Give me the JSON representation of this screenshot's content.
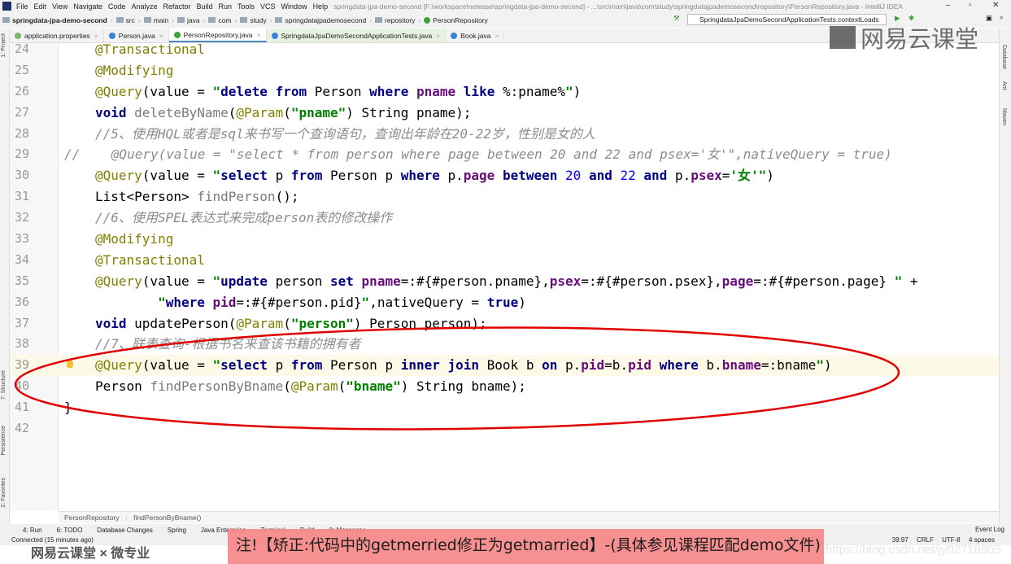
{
  "menubar": {
    "items": [
      "File",
      "Edit",
      "View",
      "Navigate",
      "Code",
      "Analyze",
      "Refactor",
      "Build",
      "Run",
      "Tools",
      "VCS",
      "Window",
      "Help"
    ],
    "title": "springdata-jpa-demo-second [F:\\workspace\\netease\\springdata-jpa-demo-second] - ...\\src\\main\\java\\com\\study\\springdatajpademosecond\\repository\\PersonRepository.java - IntelliJ IDEA"
  },
  "navbar": {
    "crumbs": [
      "springdata-jpa-demo-second",
      "src",
      "main",
      "java",
      "com",
      "study",
      "springdatajpademosecond",
      "repository",
      "PersonRepository"
    ],
    "run_config": "SpringdataJpaDemoSecondApplicationTests.contextLoads"
  },
  "tabs": [
    {
      "label": "application.properties"
    },
    {
      "label": "Person.java"
    },
    {
      "label": "PersonRepository.java",
      "active": true
    },
    {
      "label": "SpringdataJpaDemoSecondApplicationTests.java"
    },
    {
      "label": "Book.java"
    }
  ],
  "left_tools": [
    "1: Project",
    "7: Structure",
    "Persistence",
    "2: Favorites"
  ],
  "right_tools": [
    "Database",
    "Ant",
    "Maven"
  ],
  "code": {
    "lines": [
      {
        "n": "24",
        "t": [
          [
            "ann",
            "@Transactional"
          ]
        ]
      },
      {
        "n": "25",
        "t": [
          [
            "ann",
            "@Modifying"
          ]
        ]
      },
      {
        "n": "26",
        "t": [
          [
            "ann",
            "@Query"
          ],
          [
            "pl",
            "(value = "
          ],
          [
            "str",
            "\""
          ],
          [
            "kw",
            "delete"
          ],
          [
            "pl",
            " "
          ],
          [
            "kw",
            "from"
          ],
          [
            "pl",
            " Person "
          ],
          [
            "kw",
            "where"
          ],
          [
            "pl",
            " "
          ],
          [
            "fld",
            "pname"
          ],
          [
            "pl",
            " "
          ],
          [
            "kw",
            "like"
          ],
          [
            "pl",
            " %:pname%"
          ],
          [
            "str",
            "\""
          ],
          [
            "pl",
            ")"
          ]
        ]
      },
      {
        "n": "27",
        "t": [
          [
            "kw",
            "void"
          ],
          [
            "pl",
            " "
          ],
          [
            "un",
            "deleteByName"
          ],
          [
            "pl",
            "("
          ],
          [
            "ann",
            "@Param"
          ],
          [
            "pl",
            "("
          ],
          [
            "str",
            "\"pname\""
          ],
          [
            "pl",
            ") String pname);"
          ]
        ]
      },
      {
        "n": "28",
        "t": [
          [
            "cmt",
            "//5、使用HQL或者是sql来书写一个查询语句，查询出年龄在20-22岁，性别是女的人"
          ]
        ]
      },
      {
        "n": "29",
        "t": [
          [
            "cmt",
            "//    @Query(value = \"select * from person where page between 20 and 22 and psex='女'\",nativeQuery = true)"
          ]
        ],
        "outdent": true
      },
      {
        "n": "30",
        "t": [
          [
            "ann",
            "@Query"
          ],
          [
            "pl",
            "(value = "
          ],
          [
            "str",
            "\""
          ],
          [
            "kw",
            "select"
          ],
          [
            "pl",
            " p "
          ],
          [
            "kw",
            "from"
          ],
          [
            "pl",
            " Person p "
          ],
          [
            "kw",
            "where"
          ],
          [
            "pl",
            " p."
          ],
          [
            "fld",
            "page"
          ],
          [
            "pl",
            " "
          ],
          [
            "kw",
            "between"
          ],
          [
            "pl",
            " "
          ],
          [
            "num",
            "20"
          ],
          [
            "pl",
            " "
          ],
          [
            "kw",
            "and"
          ],
          [
            "pl",
            " "
          ],
          [
            "num",
            "22"
          ],
          [
            "pl",
            " "
          ],
          [
            "kw",
            "and"
          ],
          [
            "pl",
            " p."
          ],
          [
            "fld",
            "psex"
          ],
          [
            "pl",
            "="
          ],
          [
            "str",
            "'女'"
          ],
          [
            "str",
            "\""
          ],
          [
            "pl",
            ")"
          ]
        ]
      },
      {
        "n": "31",
        "t": [
          [
            "pl",
            "List<Person> "
          ],
          [
            "un",
            "findPerson"
          ],
          [
            "pl",
            "();"
          ]
        ]
      },
      {
        "n": "32",
        "t": [
          [
            "cmt",
            "//6、使用SPEL表达式来完成person表的修改操作"
          ]
        ]
      },
      {
        "n": "33",
        "t": [
          [
            "ann",
            "@Modifying"
          ]
        ]
      },
      {
        "n": "34",
        "t": [
          [
            "ann",
            "@Transactional"
          ]
        ]
      },
      {
        "n": "35",
        "t": [
          [
            "ann",
            "@Query"
          ],
          [
            "pl",
            "(value = "
          ],
          [
            "str",
            "\""
          ],
          [
            "kw",
            "update"
          ],
          [
            "pl",
            " person "
          ],
          [
            "kw",
            "set"
          ],
          [
            "pl",
            " "
          ],
          [
            "fld",
            "pname"
          ],
          [
            "pl",
            "=:#{#person.pname},"
          ],
          [
            "fld",
            "psex"
          ],
          [
            "pl",
            "=:#{#person.psex},"
          ],
          [
            "fld",
            "page"
          ],
          [
            "pl",
            "=:#{#person.page} "
          ],
          [
            "str",
            "\""
          ],
          [
            "pl",
            " +"
          ]
        ]
      },
      {
        "n": "36",
        "t": [
          [
            "pl",
            "        "
          ],
          [
            "str",
            "\""
          ],
          [
            "kw",
            "where"
          ],
          [
            "pl",
            " "
          ],
          [
            "fld",
            "pid"
          ],
          [
            "pl",
            "=:#{#person.pid}"
          ],
          [
            "str",
            "\""
          ],
          [
            "pl",
            ",nativeQuery = "
          ],
          [
            "kw",
            "true"
          ],
          [
            "pl",
            ")"
          ]
        ]
      },
      {
        "n": "37",
        "t": [
          [
            "kw",
            "void"
          ],
          [
            "pl",
            " updatePerson("
          ],
          [
            "ann",
            "@Param"
          ],
          [
            "pl",
            "("
          ],
          [
            "str",
            "\"person\""
          ],
          [
            "pl",
            ") Person person);"
          ]
        ]
      },
      {
        "n": "38",
        "t": [
          [
            "cmt",
            "//7、联表查询-根据书名来查该书籍的拥有者"
          ]
        ]
      },
      {
        "n": "39",
        "t": [
          [
            "ann",
            "@Query"
          ],
          [
            "pl",
            "(value = "
          ],
          [
            "str",
            "\""
          ],
          [
            "kw",
            "select"
          ],
          [
            "pl",
            " p "
          ],
          [
            "kw",
            "from"
          ],
          [
            "pl",
            " Person p "
          ],
          [
            "kw",
            "inner join"
          ],
          [
            "pl",
            " Book b "
          ],
          [
            "kw",
            "on"
          ],
          [
            "pl",
            " p."
          ],
          [
            "fld",
            "pid"
          ],
          [
            "pl",
            "=b."
          ],
          [
            "fld",
            "pid"
          ],
          [
            "pl",
            " "
          ],
          [
            "kw",
            "where"
          ],
          [
            "pl",
            " b."
          ],
          [
            "fld",
            "bname"
          ],
          [
            "pl",
            "=:bname"
          ],
          [
            "str",
            "\""
          ],
          [
            "pl",
            ")"
          ]
        ],
        "current": true
      },
      {
        "n": "40",
        "t": [
          [
            "pl",
            "Person "
          ],
          [
            "un",
            "findPersonByBname"
          ],
          [
            "pl",
            "("
          ],
          [
            "ann",
            "@Param"
          ],
          [
            "pl",
            "("
          ],
          [
            "str",
            "\"bname\""
          ],
          [
            "pl",
            ") String bname);"
          ]
        ]
      },
      {
        "n": "41",
        "t": [
          [
            "pl",
            "}"
          ]
        ],
        "outdent": true
      },
      {
        "n": "42",
        "t": []
      }
    ]
  },
  "breadcrumb": [
    "PersonRepository",
    "findPersonByBname()"
  ],
  "toolwindows": [
    "4: Run",
    "6: TODO",
    "Database Changes",
    "Spring",
    "Java Enterprise",
    "Terminal",
    "Build",
    "0: Messages"
  ],
  "status": {
    "left": "Connected (15 minutes ago)",
    "event_log": "Event Log",
    "position": "39:97",
    "line_sep": "CRLF",
    "encoding": "UTF-8",
    "indent": "4 spaces"
  },
  "notice": "注!【矫正:代码中的getmerried修正为getmarried】-(具体参见课程匹配demo文件)",
  "watermark": {
    "top": "网易云课堂",
    "bottom": "网易云课堂 × 微专业",
    "csdn": "https://blog.csdn.net/jy02718805"
  },
  "colors": {
    "annotation": "#808000",
    "keyword": "#000080",
    "string": "#008000",
    "field": "#660e7a",
    "comment": "#8c8c8c",
    "highlight_ellipse": "#e00000",
    "notice_bg": "#f78b8b"
  }
}
